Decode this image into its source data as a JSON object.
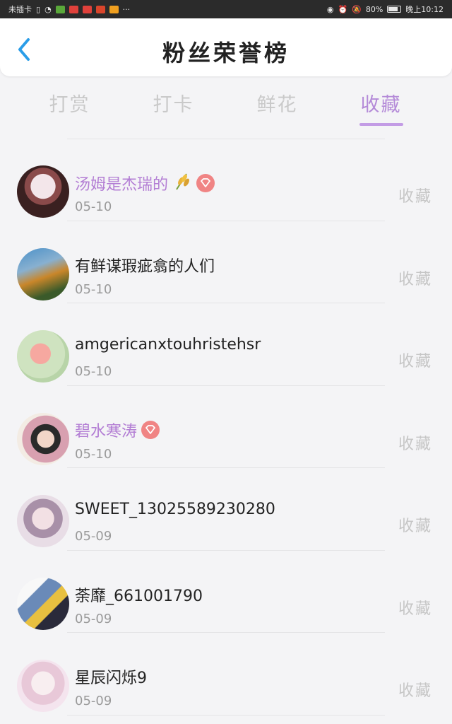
{
  "status_bar": {
    "carrier": "未插卡",
    "battery": "80%",
    "battery_level": 0.8,
    "time": "晚上10:12"
  },
  "header": {
    "title": "粉丝荣誉榜"
  },
  "tabs": [
    {
      "label": "打赏",
      "active": false
    },
    {
      "label": "打卡",
      "active": false
    },
    {
      "label": "鲜花",
      "active": false
    },
    {
      "label": "收藏",
      "active": true
    }
  ],
  "colors": {
    "accent": "#b48ad8",
    "vip_name": "#b37ed4",
    "vip_badge": "#f08484"
  },
  "fans": [
    {
      "name": "汤姆是杰瑞的",
      "date": "05-10",
      "action": "收藏",
      "vip": true,
      "extra_icon": "wheat-icon"
    },
    {
      "name": "有鲜谋瑕疵翕的人们",
      "date": "05-10",
      "action": "收藏",
      "vip": false
    },
    {
      "name": "amgericanxtouhristehsr",
      "date": "05-10",
      "action": "收藏",
      "vip": false
    },
    {
      "name": "碧水寒涛",
      "date": "05-10",
      "action": "收藏",
      "vip": true
    },
    {
      "name": "SWEET_13025589230280",
      "date": "05-09",
      "action": "收藏",
      "vip": false
    },
    {
      "name": "荼靡_661001790",
      "date": "05-09",
      "action": "收藏",
      "vip": false
    },
    {
      "name": "星辰闪烁9",
      "date": "05-09",
      "action": "收藏",
      "vip": false
    }
  ]
}
